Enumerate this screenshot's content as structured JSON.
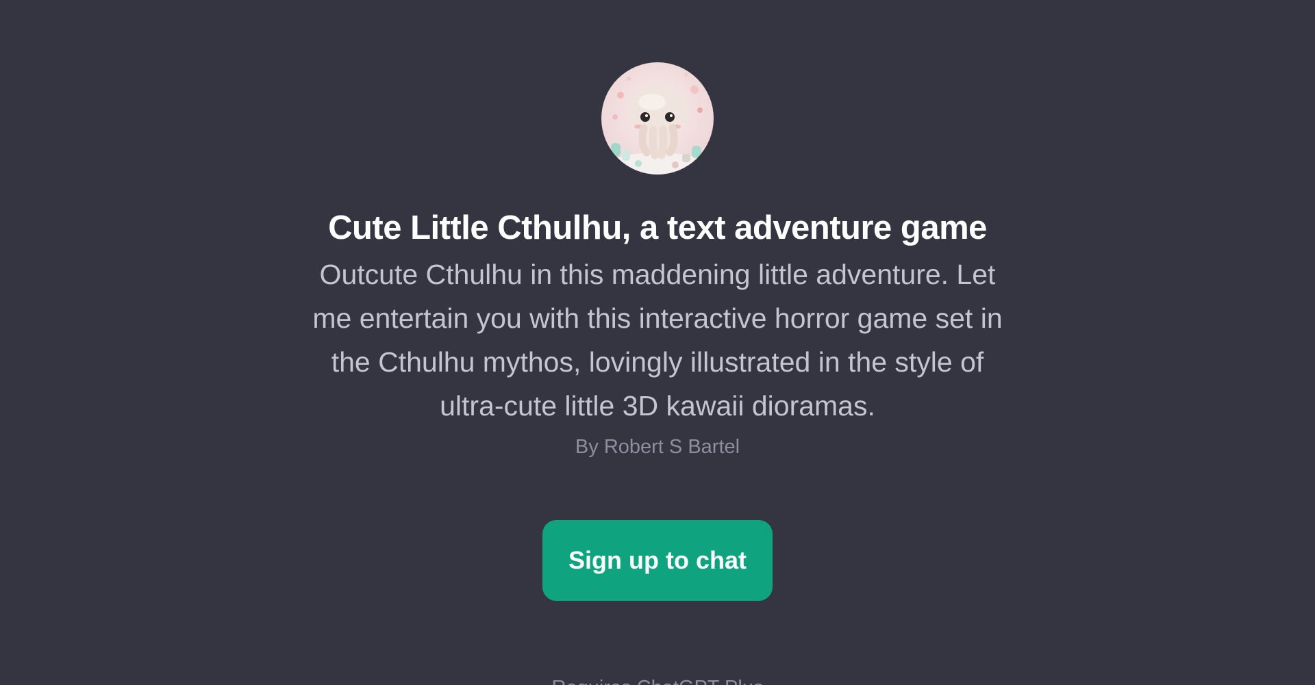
{
  "gpt": {
    "avatar_icon": "cthulhu-avatar-icon",
    "title": "Cute Little Cthulhu, a text adventure game",
    "description": "Outcute Cthulhu in this maddening little adventure. Let me entertain you with this interactive horror game set in the Cthulhu mythos, lovingly illustrated in the style of ultra-cute little 3D kawaii dioramas.",
    "author": "By Robert S Bartel"
  },
  "actions": {
    "signup_label": "Sign up to chat"
  },
  "footer": {
    "text": "Requires ChatGPT Plus"
  },
  "colors": {
    "background": "#343541",
    "accent": "#10a37f"
  }
}
